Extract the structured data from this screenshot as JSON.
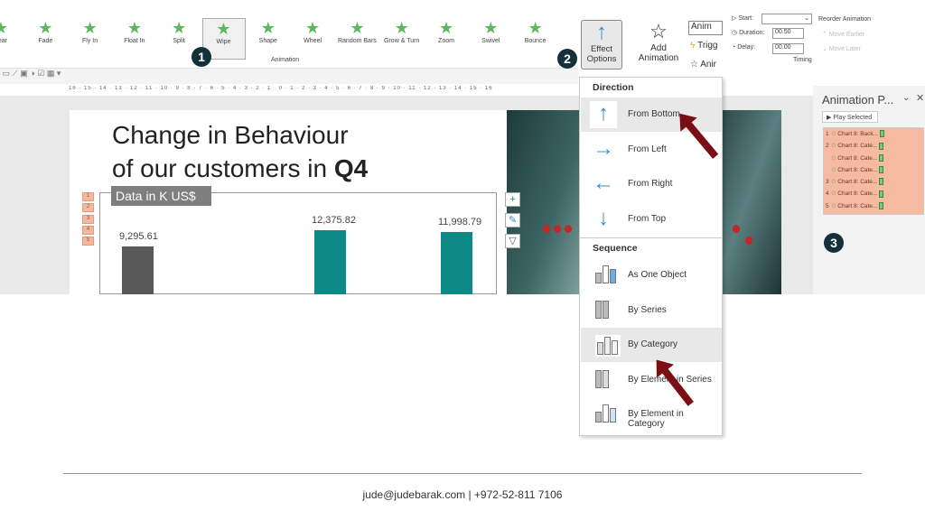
{
  "ribbon": {
    "gallery": [
      "pear",
      "Fade",
      "Fly In",
      "Float In",
      "Split",
      "Wipe",
      "Shape",
      "Wheel",
      "Random Bars",
      "Grow & Turn",
      "Zoom",
      "Swivel",
      "Bounce"
    ],
    "selected": "Wipe",
    "group_label": "Animation",
    "effect_options": "Effect Options",
    "add_animation": "Add Animation",
    "anim_pane_btn": "Anim",
    "trigger_btn": "Trigg",
    "anim_painter_btn": "Anir"
  },
  "timing": {
    "start_label": "Start:",
    "start_value": "",
    "duration_label": "Duration:",
    "duration_value": "00.50",
    "delay_label": "Delay:",
    "delay_value": "00.00",
    "group_label": "Timing",
    "reorder_label": "Reorder Animation",
    "move_earlier": "Move Earlier",
    "move_later": "Move Later"
  },
  "ruler": "16 · 15 · 14 · 13 · 12 · 11 · 10 · 9 · 8 · 7 · 6 · 5 · 4 · 3 · 2 · 1 · 0 · 1 · 2 · 3 · 4 · 5 · 6 · 7 · 8 · 9 · 10 · 11 · 12 · 13 · 14 · 15 · 16",
  "slide": {
    "title_line1": "Change in Behaviour",
    "title_line2_pre": "of our customers in ",
    "title_line2_bold": "Q4",
    "data_label": "Data in K US$",
    "tags": [
      "1",
      "2",
      "3",
      "4",
      "5"
    ]
  },
  "chart_data": {
    "type": "bar",
    "values": [
      9295.61,
      12375.82,
      11998.79
    ],
    "labels": [
      "9,295.61",
      "12,375.82",
      "11,998.79"
    ],
    "colors": [
      "#595959",
      "#0e8a86",
      "#0e8a86"
    ]
  },
  "menu": {
    "direction_header": "Direction",
    "direction": [
      "From Bottom",
      "From Left",
      "From Right",
      "From Top"
    ],
    "direction_selected": "From Bottom",
    "sequence_header": "Sequence",
    "sequence": [
      "As One Object",
      "By Series",
      "By Category",
      "By Element in Series",
      "By Element in Category"
    ],
    "sequence_selected": "By Category"
  },
  "pane": {
    "title": "Animation P...",
    "play_selected": "Play Selected",
    "items": [
      {
        "n": "1",
        "t": "Chart 8: Back..."
      },
      {
        "n": "2",
        "t": "Chart 8: Cate..."
      },
      {
        "n": "",
        "t": "Chart 8: Cate..."
      },
      {
        "n": "",
        "t": "Chart 8: Cate..."
      },
      {
        "n": "3",
        "t": "Chart 8: Cate..."
      },
      {
        "n": "4",
        "t": "Chart 8: Cate..."
      },
      {
        "n": "5",
        "t": "Chart 8: Cate..."
      }
    ]
  },
  "badges": [
    "1",
    "2",
    "3"
  ],
  "footer": "jude@judebarak.com | +972-52-811 7106"
}
